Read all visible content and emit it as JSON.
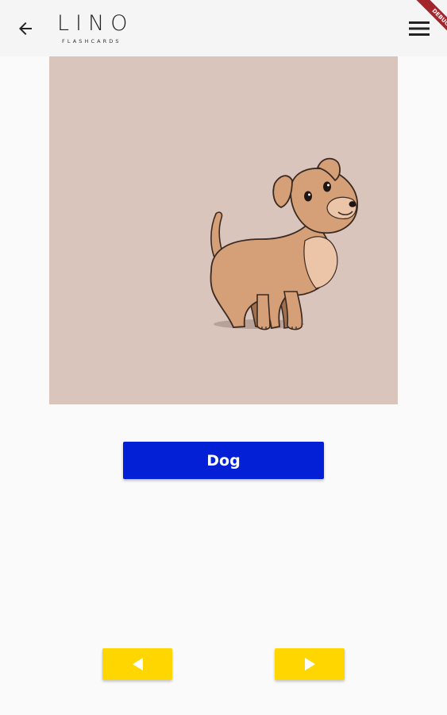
{
  "app": {
    "logo_text": "LINO",
    "logo_subtitle": "FLASHCARDS",
    "debug_banner": "DEBUG"
  },
  "card": {
    "image": "dog-illustration",
    "word": "Dog"
  },
  "icons": {
    "back": "arrow-left-icon",
    "menu": "hamburger-menu-icon",
    "previous": "triangle-left-icon",
    "next": "triangle-right-icon"
  },
  "colors": {
    "appbar_bg": "#f5f5f5",
    "image_bg": "#dac5bc",
    "word_button_bg": "#0320d6",
    "nav_button_bg": "#ffd600",
    "debug_ribbon": "#a3262c"
  }
}
